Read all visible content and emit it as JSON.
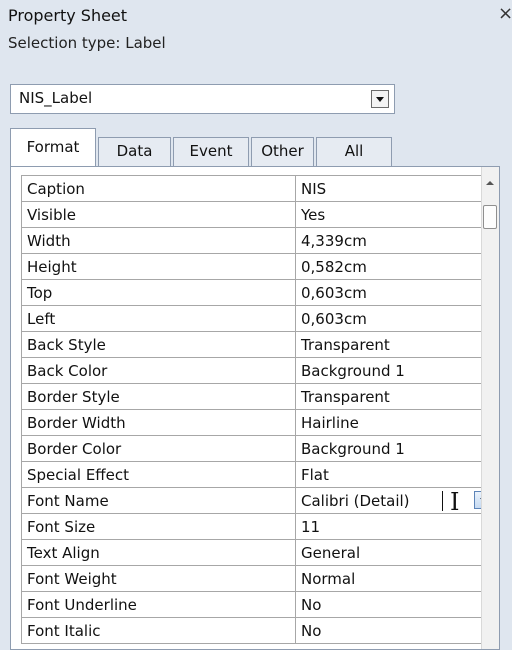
{
  "window": {
    "title": "Property Sheet",
    "close_icon": "×"
  },
  "selection": {
    "label": "Selection type:  Label"
  },
  "selector": {
    "value": "NIS_Label"
  },
  "tabs": [
    {
      "label": "Format",
      "active": true
    },
    {
      "label": "Data",
      "active": false
    },
    {
      "label": "Event",
      "active": false
    },
    {
      "label": "Other",
      "active": false
    },
    {
      "label": "All",
      "active": false
    }
  ],
  "properties": [
    {
      "name": "Caption",
      "value": "NIS"
    },
    {
      "name": "Visible",
      "value": "Yes"
    },
    {
      "name": "Width",
      "value": "4,339cm"
    },
    {
      "name": "Height",
      "value": "0,582cm"
    },
    {
      "name": "Top",
      "value": "0,603cm"
    },
    {
      "name": "Left",
      "value": "0,603cm"
    },
    {
      "name": "Back Style",
      "value": "Transparent"
    },
    {
      "name": "Back Color",
      "value": "Background 1"
    },
    {
      "name": "Border Style",
      "value": "Transparent"
    },
    {
      "name": "Border Width",
      "value": "Hairline"
    },
    {
      "name": "Border Color",
      "value": "Background 1"
    },
    {
      "name": "Special Effect",
      "value": "Flat"
    },
    {
      "name": "Font Name",
      "value": "Calibri (Detail)"
    },
    {
      "name": "Font Size",
      "value": "11"
    },
    {
      "name": "Text Align",
      "value": "General"
    },
    {
      "name": "Font Weight",
      "value": "Normal"
    },
    {
      "name": "Font Underline",
      "value": "No"
    },
    {
      "name": "Font Italic",
      "value": "No"
    }
  ],
  "icons": {
    "dropdown_arrow": "chevron-down-icon",
    "scroll_up": "scroll-up-icon",
    "text_cursor": "text-cursor-icon",
    "ibeam_glyph": "I"
  },
  "colors": {
    "background": "#dfe6ef",
    "panel": "#ffffff",
    "border": "#8e9cb0",
    "grid": "#a7a7a7"
  }
}
